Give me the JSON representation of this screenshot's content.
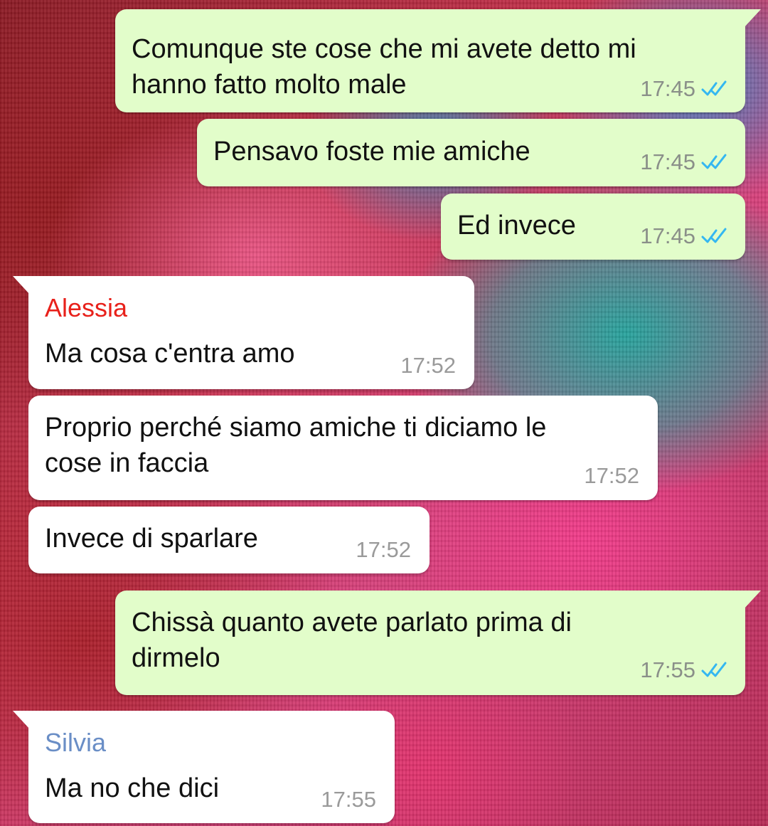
{
  "colors": {
    "outgoing_bubble": "#e2fdca",
    "incoming_bubble": "#ffffff",
    "read_check": "#34b7f1",
    "sender_alessia": "#e8211b",
    "sender_silvia": "#6a8ec6",
    "timestamp": "#8a8f89"
  },
  "messages": [
    {
      "direction": "out",
      "text": "Comunque ste cose che mi avete detto mi\nhanno fatto molto male",
      "time": "17:45",
      "status_icon": "double-check-read-icon"
    },
    {
      "direction": "out",
      "text": "Pensavo foste mie amiche",
      "time": "17:45",
      "status_icon": "double-check-read-icon"
    },
    {
      "direction": "out",
      "text": "Ed invece",
      "time": "17:45",
      "status_icon": "double-check-read-icon"
    },
    {
      "direction": "in",
      "sender": "Alessia",
      "text": "Ma cosa c'entra amo",
      "time": "17:52"
    },
    {
      "direction": "in",
      "text": "Proprio perché siamo amiche ti diciamo le\ncose in faccia",
      "time": "17:52"
    },
    {
      "direction": "in",
      "text": "Invece di sparlare",
      "time": "17:52"
    },
    {
      "direction": "out",
      "text": "Chissà quanto avete parlato prima di\ndirmelo",
      "time": "17:55",
      "status_icon": "double-check-read-icon"
    },
    {
      "direction": "in",
      "sender": "Silvia",
      "text": "Ma no che dici",
      "time": "17:55"
    }
  ]
}
